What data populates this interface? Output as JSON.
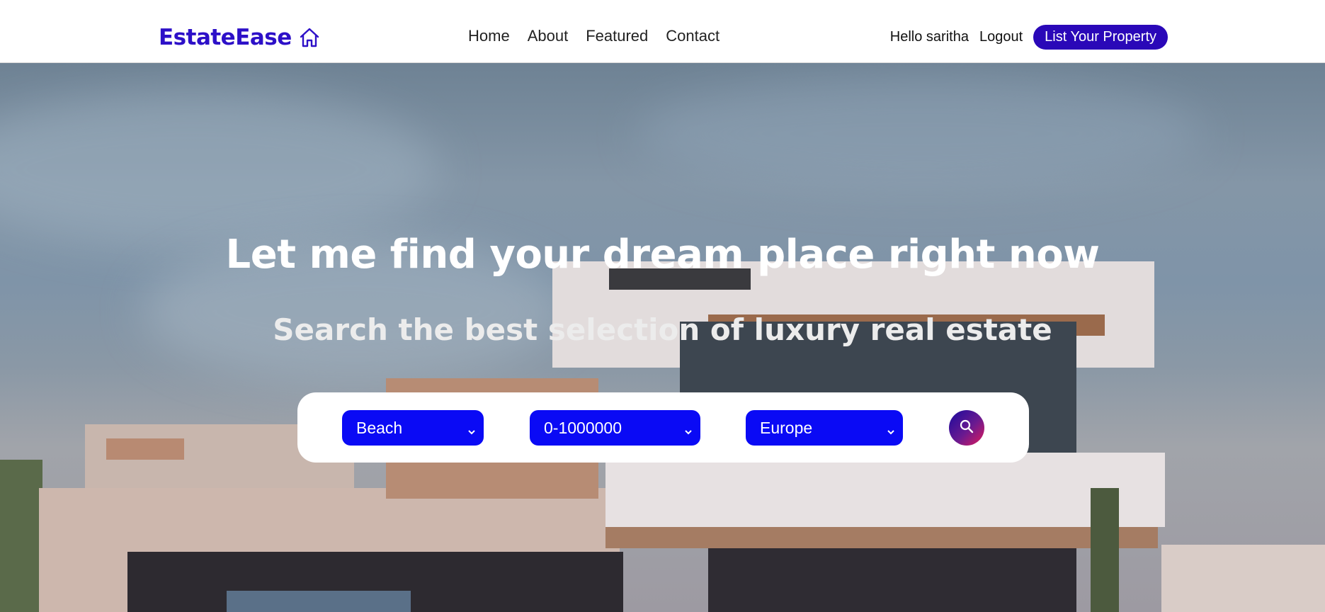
{
  "brand": {
    "name": "EstateEase",
    "icon": "home-icon",
    "color": "#2d10c8"
  },
  "nav": {
    "links": [
      "Home",
      "About",
      "Featured",
      "Contact"
    ]
  },
  "user": {
    "greeting": "Hello saritha",
    "logout": "Logout",
    "list_property": "List Your Property"
  },
  "hero": {
    "title": "Let me find your dream place right now",
    "subtitle": "Search the best selection of luxury real estate"
  },
  "search": {
    "type": "Beach",
    "price": "0-1000000",
    "location": "Europe",
    "button_icon": "search-icon"
  },
  "colors": {
    "accent": "#2a08b8",
    "select_bg": "#0a0af5"
  }
}
